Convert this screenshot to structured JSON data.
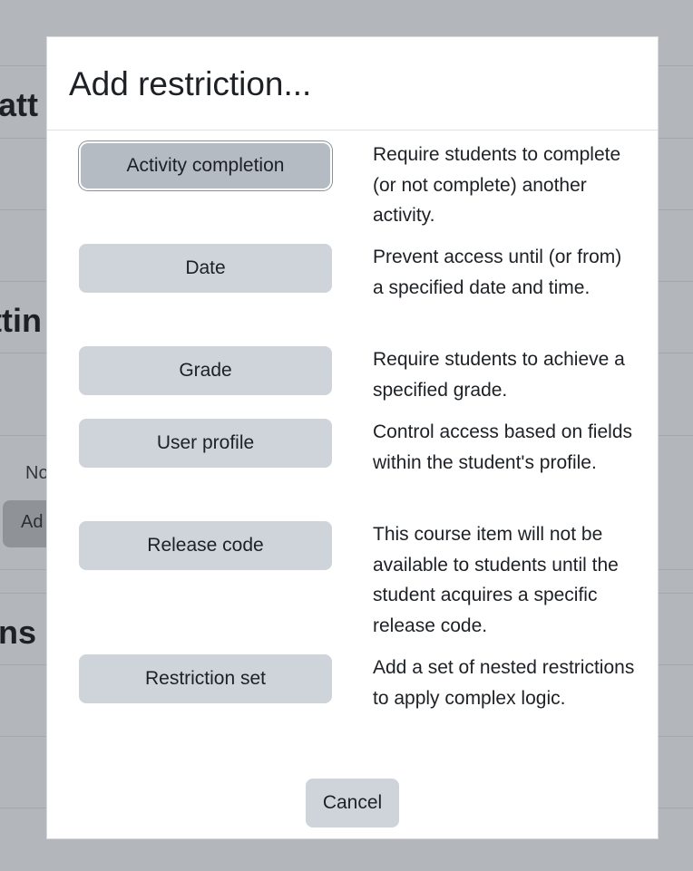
{
  "background": {
    "fragments": [
      "att",
      "ttin",
      "ns"
    ],
    "small_label": "No",
    "button_label": "Ad"
  },
  "modal": {
    "title": "Add restriction...",
    "options": [
      {
        "label": "Activity completion",
        "description": "Require students to complete (or not complete) another activity."
      },
      {
        "label": "Date",
        "description": "Prevent access until (or from) a specified date and time."
      },
      {
        "label": "Grade",
        "description": "Require students to achieve a specified grade."
      },
      {
        "label": "User profile",
        "description": "Control access based on fields within the student's profile."
      },
      {
        "label": "Release code",
        "description": "This course item will not be available to students until the student acquires a specific release code."
      },
      {
        "label": "Restriction set",
        "description": "Add a set of nested restrictions to apply complex logic."
      }
    ],
    "cancel_label": "Cancel"
  }
}
